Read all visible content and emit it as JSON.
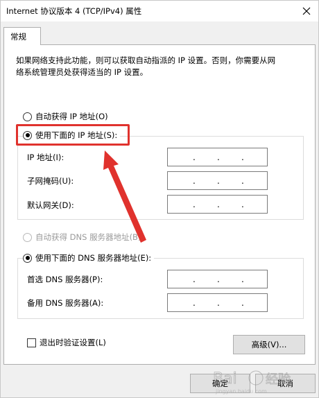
{
  "window": {
    "title": "Internet 协议版本 4 (TCP/IPv4) 属性"
  },
  "tabs": [
    {
      "label": "常规"
    }
  ],
  "description": {
    "line1": "如果网络支持此功能，则可以获取自动指派的 IP 设置。否则，你需要从网",
    "line2": "络系统管理员处获得适当的 IP 设置。"
  },
  "ip_mode": {
    "auto_label": "自动获得 IP 地址(O)",
    "manual_label": "使用下面的 IP 地址(S):",
    "selected": "manual"
  },
  "ip_fields": [
    {
      "label": "IP 地址(I):",
      "value": ""
    },
    {
      "label": "子网掩码(U):",
      "value": ""
    },
    {
      "label": "默认网关(D):",
      "value": ""
    }
  ],
  "dns_mode": {
    "auto_label": "自动获得 DNS 服务器地址(B)",
    "manual_label": "使用下面的 DNS 服务器地址(E):",
    "selected": "manual",
    "auto_disabled": true
  },
  "dns_fields": [
    {
      "label": "首选 DNS 服务器(P):",
      "value": ""
    },
    {
      "label": "备用 DNS 服务器(A):",
      "value": ""
    }
  ],
  "validate_on_exit": {
    "label": "退出时验证设置(L)",
    "checked": false
  },
  "buttons": {
    "advanced": "高级(V)...",
    "ok": "确定",
    "cancel": "取消"
  },
  "annotation": {
    "color": "#e0322d"
  },
  "icons": {
    "close": "close-icon"
  }
}
